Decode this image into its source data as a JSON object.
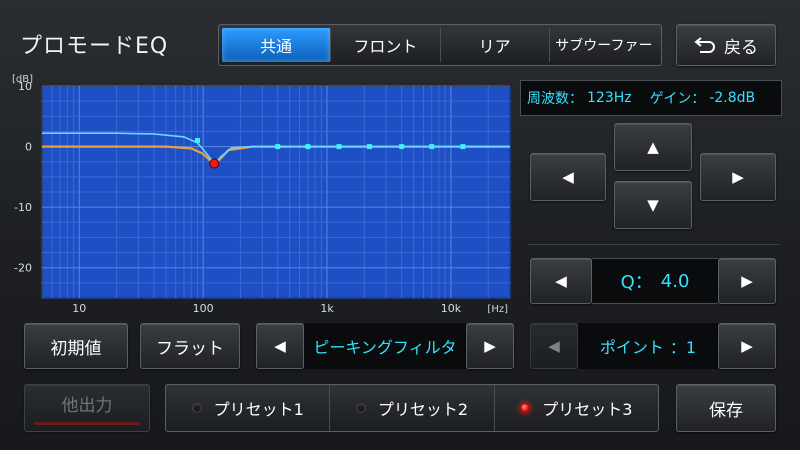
{
  "app": {
    "title": "プロモードEQ"
  },
  "tabs": [
    {
      "label": "共通",
      "active": true
    },
    {
      "label": "フロント",
      "active": false
    },
    {
      "label": "リア",
      "active": false
    },
    {
      "label": "サブウーファー",
      "active": false
    }
  ],
  "back": {
    "icon": "return-arrow-icon",
    "label": "戻る"
  },
  "readout": {
    "freq_label": "周波数：",
    "freq_value": "123Hz",
    "gain_label": "ゲイン：",
    "gain_value": "-2.8dB"
  },
  "nav": {
    "up": "▲",
    "down": "▼",
    "left": "◀",
    "right": "▶"
  },
  "q": {
    "label": "Q：",
    "value": "4.0"
  },
  "filter": {
    "value": "ピーキングフィルタ"
  },
  "point": {
    "label": "ポイント",
    "value": "：1"
  },
  "buttons": {
    "init": "初期値",
    "flat": "フラット",
    "other_output": "他出力",
    "save": "保存"
  },
  "presets": [
    {
      "label": "プリセット1",
      "active": false
    },
    {
      "label": "プリセット2",
      "active": false
    },
    {
      "label": "プリセット3",
      "active": true
    }
  ],
  "colors": {
    "accent": "#33e0ff",
    "plot_bg": "#1e4fc4",
    "flat_curve": "#e8a13c",
    "active_curve": "#6fd3ff",
    "selected_point": "#e81b1b"
  },
  "chart_data": {
    "type": "line",
    "xscale": "log",
    "xlim": [
      5,
      30000
    ],
    "ylim": [
      -25,
      10
    ],
    "ylabel": "dB",
    "xlabel": "Hz",
    "yticks": [
      10,
      0,
      -10,
      -20
    ],
    "xticks": [
      {
        "v": 10,
        "label": "10"
      },
      {
        "v": 100,
        "label": "100"
      },
      {
        "v": 1000,
        "label": "1k"
      },
      {
        "v": 10000,
        "label": "10k"
      }
    ],
    "grid": true,
    "series": [
      {
        "x": [
          5,
          20,
          50,
          80,
          100,
          115,
          123,
          135,
          160,
          250,
          1000,
          30000
        ],
        "y": [
          0,
          0,
          0,
          -0.3,
          -1.2,
          -2.4,
          -2.8,
          -2.2,
          -0.6,
          0,
          0,
          0
        ]
      },
      {
        "x": [
          5,
          20,
          40,
          70,
          90,
          105,
          123,
          140,
          170,
          250,
          1000,
          30000
        ],
        "y": [
          2.2,
          2.2,
          2.1,
          1.6,
          0.6,
          -1.0,
          -2.8,
          -1.6,
          -0.2,
          0,
          0,
          0
        ]
      }
    ],
    "points": [
      {
        "x": 90,
        "y": 1.0,
        "selected": false
      },
      {
        "x": 123,
        "y": -2.8,
        "selected": true
      },
      {
        "x": 400,
        "y": 0,
        "selected": false
      },
      {
        "x": 700,
        "y": 0,
        "selected": false
      },
      {
        "x": 1250,
        "y": 0,
        "selected": false
      },
      {
        "x": 2200,
        "y": 0,
        "selected": false
      },
      {
        "x": 4000,
        "y": 0,
        "selected": false
      },
      {
        "x": 7000,
        "y": 0,
        "selected": false
      },
      {
        "x": 12500,
        "y": 0,
        "selected": false
      }
    ]
  }
}
